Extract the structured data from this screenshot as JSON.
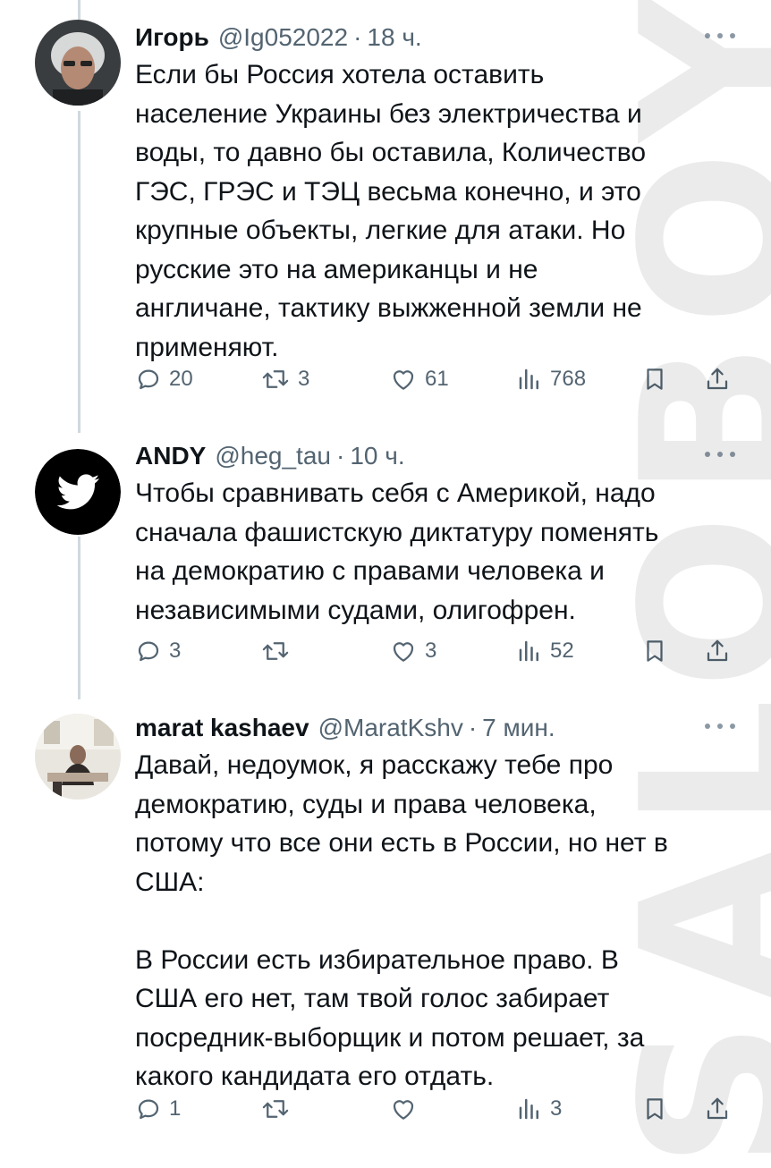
{
  "tweets": [
    {
      "name": "Игорь",
      "handle": "@Ig052022",
      "time": "18 ч.",
      "text": "Если бы Россия хотела оставить\nнаселение Украины без электричества и\nводы, то давно бы оставила, Количество\nГЭС, ГРЭС и ТЭЦ весьма конечно, и это\nкрупные объекты, легкие для атаки. Но\nрусские это на американцы и не\nангличане, тактику выжженной земли не\nприменяют.",
      "replies": "20",
      "retweets": "3",
      "likes": "61",
      "views": "768"
    },
    {
      "name": "ANDY",
      "handle": "@heg_tau",
      "time": "10 ч.",
      "text": "Чтобы сравнивать себя с Америкой, надо\nсначала фашистскую диктатуру поменять\nна демократию с правами человека и\nнезависимыми судами, олигофрен.",
      "replies": "3",
      "retweets": "",
      "likes": "3",
      "views": "52"
    },
    {
      "name": "marat kashaev",
      "handle": "@MaratKshv",
      "time": "7 мин.",
      "text": "Давай, недоумок, я расскажу тебе про\nдемократию, суды и права человека,\nпотому что все они есть в России, но нет в\nСША:\n\nВ России есть избирательное право. В\nСША его нет, там твой голос забирает\nпосредник-выборщик и потом решает, за\nкакого кандидата его отдать.",
      "replies": "1",
      "retweets": "",
      "likes": "",
      "views": "3"
    }
  ],
  "separator": "·",
  "watermark": "SALOBOY",
  "colors": {
    "text": "#0f1419",
    "secondary": "#536471",
    "thread_line": "#cfd9de",
    "avatar_andy_bg": "#000000"
  },
  "icons": [
    "reply-icon",
    "retweet-icon",
    "like-icon",
    "views-icon",
    "bookmark-icon",
    "share-icon",
    "more-icon",
    "twitter-bird-icon"
  ]
}
